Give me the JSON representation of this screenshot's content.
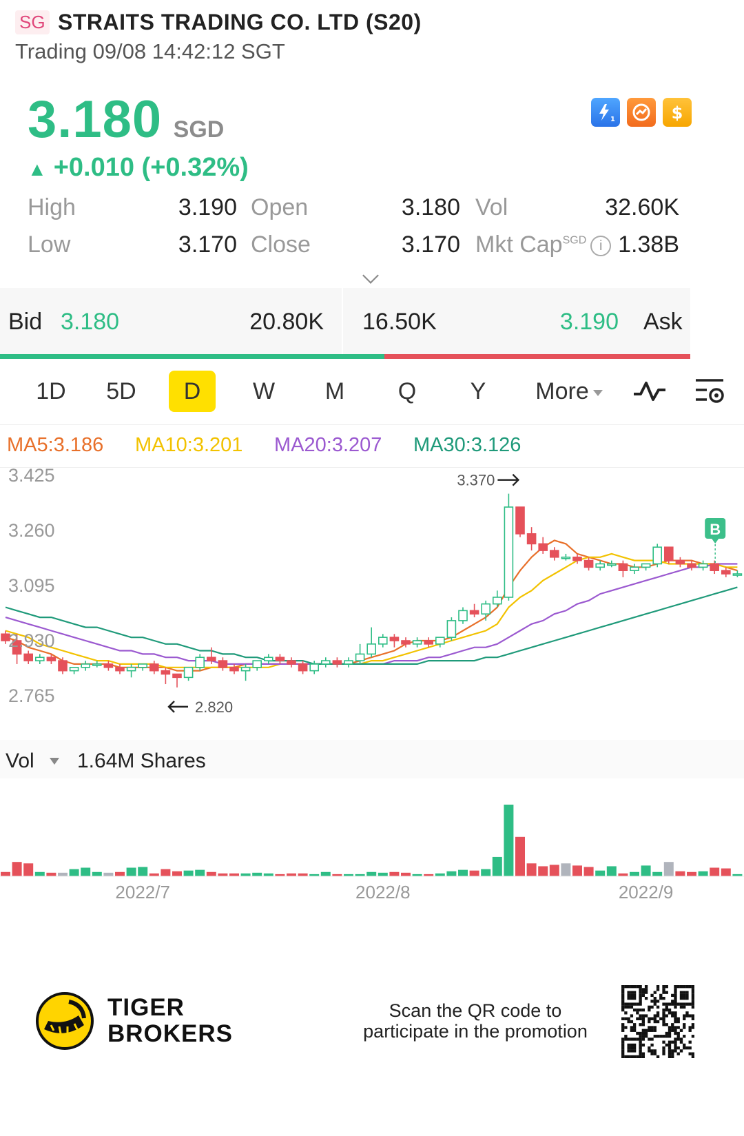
{
  "header": {
    "market_badge": "SG",
    "title": "STRAITS TRADING CO. LTD (S20)",
    "status": "Trading 09/08 14:42:12 SGT"
  },
  "quote": {
    "price": "3.180",
    "currency": "SGD",
    "change": "+0.010 (+0.32%)",
    "change_arrow": "▲",
    "up_color": "#2ebd85",
    "down_color": "#e5515a"
  },
  "top_icons": [
    "lightning-level-1-icon",
    "chart-gauge-icon",
    "dollar-coin-icon"
  ],
  "stats": {
    "high_label": "High",
    "high": "3.190",
    "open_label": "Open",
    "open": "3.180",
    "vol_label": "Vol",
    "vol": "32.60K",
    "low_label": "Low",
    "low": "3.170",
    "close_label": "Close",
    "close": "3.170",
    "mktcap_label": "Mkt Cap",
    "mktcap_currency": "SGD",
    "mktcap": "1.38B",
    "info_glyph": "i"
  },
  "bidask": {
    "bid_label": "Bid",
    "bid_price": "3.180",
    "bid_size": "20.80K",
    "ask_size": "16.50K",
    "ask_price": "3.190",
    "ask_label": "Ask",
    "bid_share": 0.557
  },
  "periods": {
    "items": [
      "1D",
      "5D",
      "D",
      "W",
      "M",
      "Q",
      "Y"
    ],
    "active": "D",
    "more_label": "More"
  },
  "ma": {
    "ma5": "MA5:3.186",
    "ma10": "MA10:3.201",
    "ma20": "MA20:3.207",
    "ma30": "MA30:3.126",
    "ma5_color": "#e8702a",
    "ma10_color": "#f2c200",
    "ma20_color": "#9b59d0",
    "ma30_color": "#1f9a7a"
  },
  "chart_data": {
    "type": "candlestick",
    "y_ticks": [
      "3.425",
      "3.260",
      "3.095",
      "2.930",
      "2.765"
    ],
    "ylim": [
      2.765,
      3.425
    ],
    "x_ticks": [
      "2022/7",
      "2022/8",
      "2022/9"
    ],
    "high_marker": "3.370",
    "low_marker": "2.820",
    "signal_label": "B",
    "candles": [
      [
        2.95,
        2.93,
        2.96,
        2.92
      ],
      [
        2.93,
        2.89,
        2.95,
        2.86
      ],
      [
        2.89,
        2.87,
        2.9,
        2.86
      ],
      [
        2.87,
        2.88,
        2.89,
        2.86
      ],
      [
        2.88,
        2.87,
        2.89,
        2.86
      ],
      [
        2.87,
        2.84,
        2.88,
        2.83
      ],
      [
        2.84,
        2.85,
        2.85,
        2.83
      ],
      [
        2.85,
        2.86,
        2.87,
        2.84
      ],
      [
        2.86,
        2.86,
        2.87,
        2.85
      ],
      [
        2.86,
        2.85,
        2.87,
        2.84
      ],
      [
        2.85,
        2.84,
        2.86,
        2.83
      ],
      [
        2.84,
        2.85,
        2.86,
        2.82
      ],
      [
        2.85,
        2.86,
        2.86,
        2.84
      ],
      [
        2.86,
        2.84,
        2.87,
        2.83
      ],
      [
        2.84,
        2.83,
        2.85,
        2.8
      ],
      [
        2.83,
        2.82,
        2.83,
        2.79
      ],
      [
        2.82,
        2.85,
        2.85,
        2.81
      ],
      [
        2.85,
        2.88,
        2.89,
        2.84
      ],
      [
        2.88,
        2.87,
        2.91,
        2.86
      ],
      [
        2.87,
        2.85,
        2.88,
        2.84
      ],
      [
        2.85,
        2.84,
        2.86,
        2.83
      ],
      [
        2.84,
        2.85,
        2.86,
        2.81
      ],
      [
        2.85,
        2.87,
        2.87,
        2.84
      ],
      [
        2.87,
        2.88,
        2.89,
        2.86
      ],
      [
        2.88,
        2.87,
        2.89,
        2.86
      ],
      [
        2.87,
        2.86,
        2.88,
        2.85
      ],
      [
        2.86,
        2.84,
        2.87,
        2.83
      ],
      [
        2.84,
        2.86,
        2.87,
        2.83
      ],
      [
        2.86,
        2.87,
        2.88,
        2.85
      ],
      [
        2.87,
        2.86,
        2.88,
        2.85
      ],
      [
        2.86,
        2.87,
        2.88,
        2.85
      ],
      [
        2.87,
        2.89,
        2.92,
        2.86
      ],
      [
        2.89,
        2.92,
        2.97,
        2.88
      ],
      [
        2.92,
        2.94,
        2.95,
        2.91
      ],
      [
        2.94,
        2.93,
        2.95,
        2.91
      ],
      [
        2.93,
        2.92,
        2.94,
        2.91
      ],
      [
        2.92,
        2.93,
        2.94,
        2.91
      ],
      [
        2.93,
        2.92,
        2.94,
        2.91
      ],
      [
        2.92,
        2.94,
        2.94,
        2.91
      ],
      [
        2.94,
        2.99,
        3.0,
        2.93
      ],
      [
        2.99,
        3.02,
        3.03,
        2.98
      ],
      [
        3.02,
        3.01,
        3.04,
        3.0
      ],
      [
        3.01,
        3.04,
        3.05,
        2.99
      ],
      [
        3.04,
        3.06,
        3.08,
        3.03
      ],
      [
        3.06,
        3.33,
        3.37,
        3.05
      ],
      [
        3.33,
        3.25,
        3.31,
        3.24
      ],
      [
        3.25,
        3.22,
        3.27,
        3.2
      ],
      [
        3.22,
        3.2,
        3.24,
        3.19
      ],
      [
        3.2,
        3.18,
        3.21,
        3.17
      ],
      [
        3.18,
        3.18,
        3.19,
        3.17
      ],
      [
        3.18,
        3.17,
        3.19,
        3.16
      ],
      [
        3.17,
        3.15,
        3.18,
        3.14
      ],
      [
        3.15,
        3.16,
        3.17,
        3.14
      ],
      [
        3.16,
        3.16,
        3.17,
        3.15
      ],
      [
        3.16,
        3.14,
        3.17,
        3.12
      ],
      [
        3.14,
        3.15,
        3.16,
        3.13
      ],
      [
        3.15,
        3.16,
        3.16,
        3.14
      ],
      [
        3.16,
        3.21,
        3.22,
        3.15
      ],
      [
        3.21,
        3.17,
        3.2,
        3.16
      ],
      [
        3.17,
        3.16,
        3.18,
        3.15
      ],
      [
        3.16,
        3.15,
        3.17,
        3.14
      ],
      [
        3.15,
        3.16,
        3.17,
        3.14
      ],
      [
        3.16,
        3.14,
        3.17,
        3.13
      ],
      [
        3.14,
        3.13,
        3.15,
        3.12
      ],
      [
        3.13,
        3.13,
        3.14,
        3.12
      ]
    ],
    "ma_series": {
      "ma5": [
        2.94,
        2.93,
        2.91,
        2.9,
        2.89,
        2.87,
        2.86,
        2.86,
        2.86,
        2.86,
        2.85,
        2.85,
        2.85,
        2.85,
        2.85,
        2.84,
        2.84,
        2.84,
        2.85,
        2.85,
        2.85,
        2.86,
        2.86,
        2.86,
        2.86,
        2.86,
        2.86,
        2.86,
        2.86,
        2.86,
        2.86,
        2.87,
        2.88,
        2.89,
        2.9,
        2.92,
        2.93,
        2.93,
        2.93,
        2.94,
        2.96,
        2.98,
        3.0,
        3.03,
        3.09,
        3.14,
        3.18,
        3.21,
        3.23,
        3.22,
        3.19,
        3.18,
        3.17,
        3.16,
        3.16,
        3.15,
        3.15,
        3.16,
        3.17,
        3.17,
        3.17,
        3.16,
        3.16,
        3.15,
        3.14
      ],
      "ma10": [
        2.96,
        2.95,
        2.94,
        2.92,
        2.91,
        2.9,
        2.89,
        2.88,
        2.87,
        2.87,
        2.86,
        2.86,
        2.86,
        2.86,
        2.85,
        2.85,
        2.85,
        2.85,
        2.85,
        2.85,
        2.85,
        2.85,
        2.85,
        2.85,
        2.86,
        2.86,
        2.86,
        2.86,
        2.86,
        2.86,
        2.86,
        2.86,
        2.87,
        2.87,
        2.88,
        2.89,
        2.9,
        2.91,
        2.92,
        2.93,
        2.94,
        2.95,
        2.96,
        2.98,
        3.03,
        3.06,
        3.08,
        3.11,
        3.13,
        3.15,
        3.17,
        3.18,
        3.18,
        3.19,
        3.18,
        3.17,
        3.17,
        3.17,
        3.16,
        3.16,
        3.16,
        3.16,
        3.16,
        3.15,
        3.15
      ],
      "ma20": [
        3.0,
        2.99,
        2.98,
        2.97,
        2.96,
        2.95,
        2.94,
        2.93,
        2.92,
        2.91,
        2.9,
        2.9,
        2.89,
        2.89,
        2.88,
        2.88,
        2.87,
        2.87,
        2.87,
        2.86,
        2.86,
        2.86,
        2.86,
        2.86,
        2.86,
        2.86,
        2.86,
        2.86,
        2.86,
        2.86,
        2.86,
        2.86,
        2.86,
        2.86,
        2.87,
        2.87,
        2.87,
        2.88,
        2.88,
        2.89,
        2.9,
        2.91,
        2.91,
        2.92,
        2.94,
        2.96,
        2.98,
        2.99,
        3.01,
        3.02,
        3.04,
        3.05,
        3.07,
        3.08,
        3.09,
        3.1,
        3.11,
        3.12,
        3.13,
        3.14,
        3.15,
        3.15,
        3.16,
        3.16,
        3.16
      ],
      "ma30": [
        3.03,
        3.02,
        3.01,
        3.0,
        3.0,
        2.99,
        2.98,
        2.97,
        2.97,
        2.96,
        2.95,
        2.94,
        2.94,
        2.93,
        2.92,
        2.92,
        2.91,
        2.9,
        2.9,
        2.89,
        2.89,
        2.88,
        2.88,
        2.87,
        2.87,
        2.87,
        2.87,
        2.86,
        2.86,
        2.86,
        2.86,
        2.86,
        2.86,
        2.86,
        2.86,
        2.86,
        2.86,
        2.87,
        2.87,
        2.87,
        2.87,
        2.87,
        2.88,
        2.88,
        2.89,
        2.9,
        2.91,
        2.92,
        2.93,
        2.94,
        2.95,
        2.96,
        2.97,
        2.98,
        2.99,
        3.0,
        3.01,
        3.02,
        3.03,
        3.04,
        3.05,
        3.06,
        3.07,
        3.08,
        3.09
      ]
    },
    "volume": [
      0.06,
      0.2,
      0.18,
      0.06,
      0.05,
      0.05,
      0.1,
      0.12,
      0.06,
      0.05,
      0.06,
      0.12,
      0.13,
      0.04,
      0.1,
      0.07,
      0.08,
      0.09,
      0.06,
      0.04,
      0.04,
      0.04,
      0.05,
      0.04,
      0.03,
      0.04,
      0.04,
      0.03,
      0.06,
      0.03,
      0.03,
      0.03,
      0.06,
      0.05,
      0.06,
      0.05,
      0.03,
      0.03,
      0.04,
      0.07,
      0.09,
      0.08,
      0.1,
      0.27,
      1.0,
      0.55,
      0.18,
      0.14,
      0.16,
      0.18,
      0.15,
      0.13,
      0.08,
      0.14,
      0.04,
      0.06,
      0.15,
      0.06,
      0.2,
      0.07,
      0.06,
      0.07,
      0.12,
      0.11,
      0.03
    ],
    "volume_colors_gray": [
      5,
      9,
      49,
      58
    ]
  },
  "volume": {
    "label": "Vol",
    "total": "1.64M Shares"
  },
  "footer": {
    "brand_line1": "TIGER",
    "brand_line2": "BROKERS",
    "promo_line1": "Scan the QR code to",
    "promo_line2": "participate in the promotion"
  }
}
